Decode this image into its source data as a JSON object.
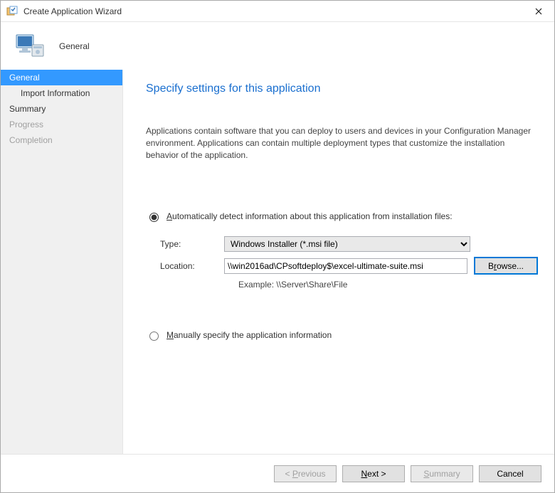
{
  "window": {
    "title": "Create Application Wizard"
  },
  "header": {
    "page_name": "General"
  },
  "sidebar": {
    "items": [
      {
        "label": "General",
        "selected": true,
        "disabled": false,
        "sub": false
      },
      {
        "label": "Import Information",
        "selected": false,
        "disabled": false,
        "sub": true
      },
      {
        "label": "Summary",
        "selected": false,
        "disabled": false,
        "sub": false
      },
      {
        "label": "Progress",
        "selected": false,
        "disabled": true,
        "sub": false
      },
      {
        "label": "Completion",
        "selected": false,
        "disabled": true,
        "sub": false
      }
    ]
  },
  "content": {
    "heading": "Specify settings for this application",
    "description": "Applications contain software that you can deploy to users and devices in your Configuration Manager environment. Applications can contain multiple deployment types that customize the installation behavior of the application.",
    "radio_auto": {
      "label_pre": "",
      "label_u": "A",
      "label_post": "utomatically detect information about this application from installation files:",
      "checked": true
    },
    "type_row": {
      "label": "Type:",
      "value": "Windows Installer (*.msi file)"
    },
    "location_row": {
      "label": "Location:",
      "value": "\\\\win2016ad\\CPsoftdeploy$\\excel-ultimate-suite.msi",
      "browse_pre": "B",
      "browse_u": "r",
      "browse_post": "owse..."
    },
    "example": "Example: \\\\Server\\Share\\File",
    "radio_manual": {
      "label_u": "M",
      "label_post": "anually specify the application information",
      "checked": false
    }
  },
  "footer": {
    "previous_pre": "< ",
    "previous_u": "P",
    "previous_post": "revious",
    "next_u": "N",
    "next_post": "ext >",
    "summary_u": "S",
    "summary_post": "ummary",
    "cancel": "Cancel"
  }
}
